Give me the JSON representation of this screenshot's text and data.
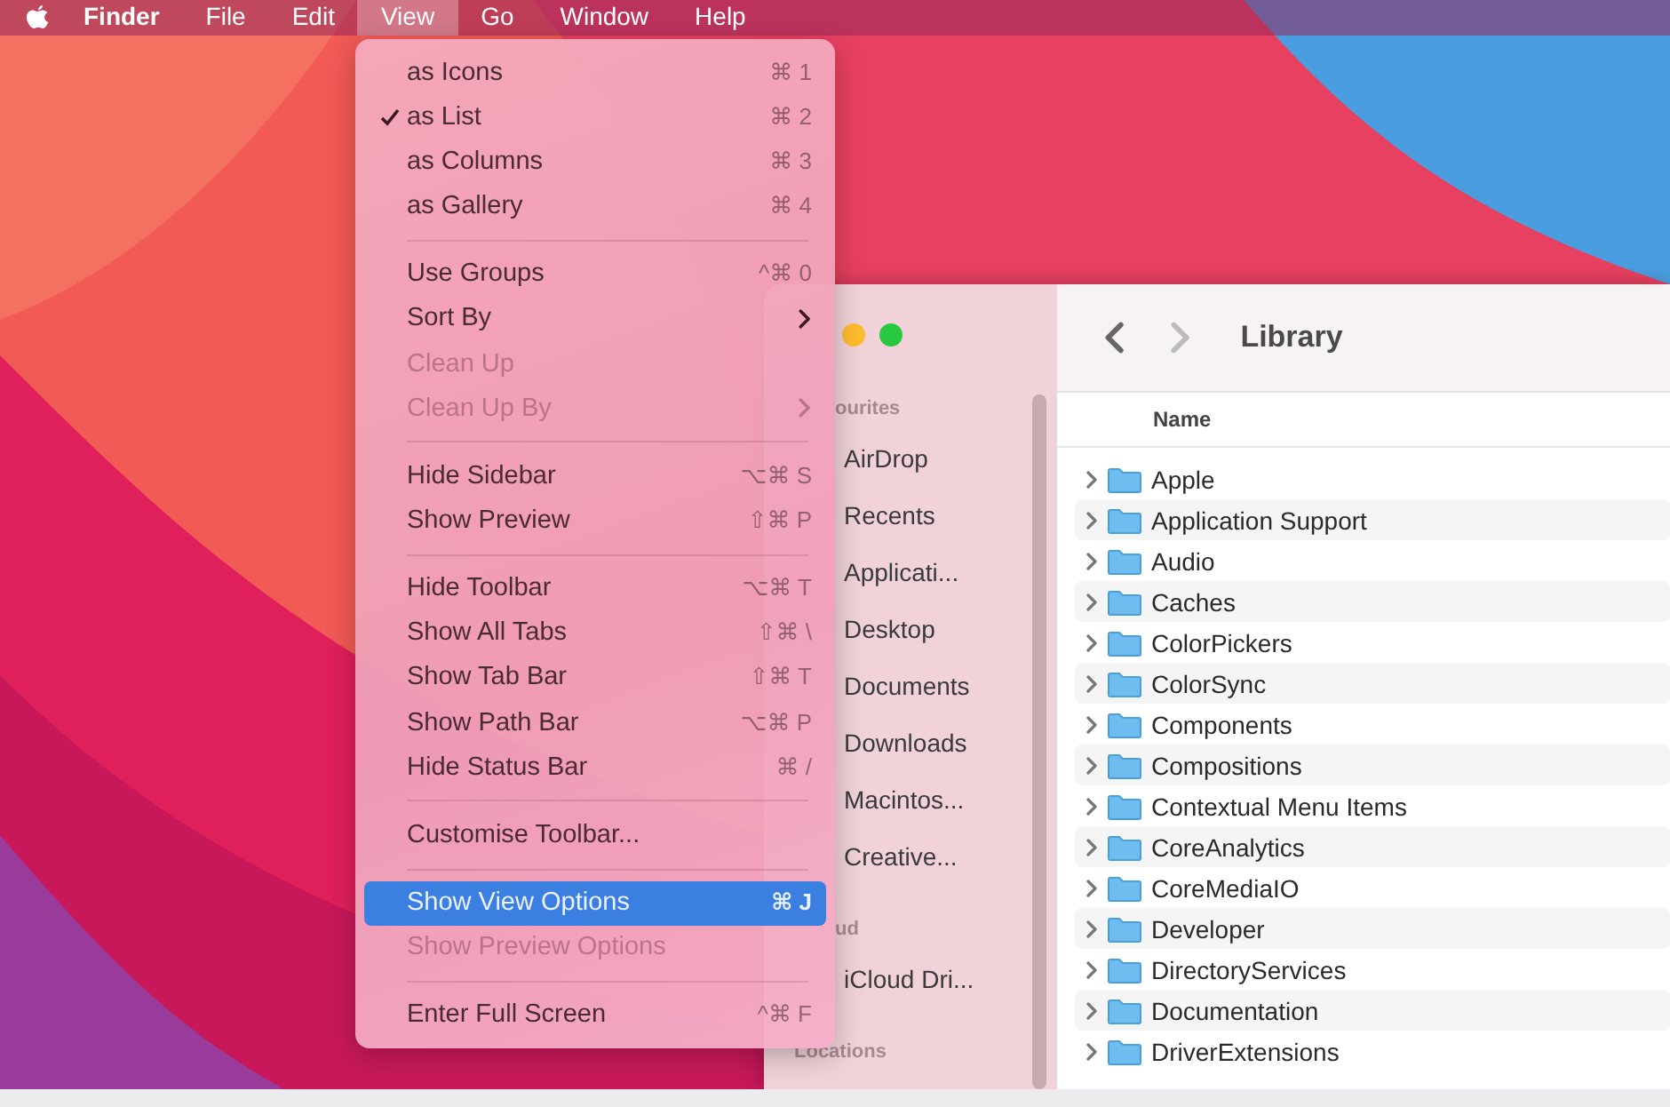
{
  "menubar": {
    "items": [
      {
        "label": "Finder",
        "kind": "app",
        "selected": false
      },
      {
        "label": "File",
        "kind": "menu",
        "selected": false
      },
      {
        "label": "Edit",
        "kind": "menu",
        "selected": false
      },
      {
        "label": "View",
        "kind": "menu",
        "selected": true
      },
      {
        "label": "Go",
        "kind": "menu",
        "selected": false
      },
      {
        "label": "Window",
        "kind": "menu",
        "selected": false
      },
      {
        "label": "Help",
        "kind": "menu",
        "selected": false
      }
    ]
  },
  "view_menu": {
    "items": [
      {
        "kind": "item",
        "label": "as Icons",
        "shortcut": "⌘ 1",
        "checked": false,
        "disabled": false,
        "selected": false,
        "submenu": false
      },
      {
        "kind": "item",
        "label": "as List",
        "shortcut": "⌘ 2",
        "checked": true,
        "disabled": false,
        "selected": false,
        "submenu": false
      },
      {
        "kind": "item",
        "label": "as Columns",
        "shortcut": "⌘ 3",
        "checked": false,
        "disabled": false,
        "selected": false,
        "submenu": false
      },
      {
        "kind": "item",
        "label": "as Gallery",
        "shortcut": "⌘ 4",
        "checked": false,
        "disabled": false,
        "selected": false,
        "submenu": false
      },
      {
        "kind": "separator"
      },
      {
        "kind": "item",
        "label": "Use Groups",
        "shortcut": "^⌘ 0",
        "checked": false,
        "disabled": false,
        "selected": false,
        "submenu": false
      },
      {
        "kind": "item",
        "label": "Sort By",
        "checked": false,
        "disabled": false,
        "selected": false,
        "submenu": true
      },
      {
        "kind": "item",
        "label": "Clean Up",
        "checked": false,
        "disabled": true,
        "selected": false,
        "submenu": false
      },
      {
        "kind": "item",
        "label": "Clean Up By",
        "checked": false,
        "disabled": true,
        "selected": false,
        "submenu": true
      },
      {
        "kind": "separator"
      },
      {
        "kind": "item",
        "label": "Hide Sidebar",
        "shortcut": "⌥⌘ S",
        "checked": false,
        "disabled": false,
        "selected": false,
        "submenu": false
      },
      {
        "kind": "item",
        "label": "Show Preview",
        "shortcut": "⇧⌘ P",
        "checked": false,
        "disabled": false,
        "selected": false,
        "submenu": false
      },
      {
        "kind": "separator"
      },
      {
        "kind": "item",
        "label": "Hide Toolbar",
        "shortcut": "⌥⌘ T",
        "checked": false,
        "disabled": false,
        "selected": false,
        "submenu": false
      },
      {
        "kind": "item",
        "label": "Show All Tabs",
        "shortcut": "⇧⌘ \\",
        "checked": false,
        "disabled": false,
        "selected": false,
        "submenu": false
      },
      {
        "kind": "item",
        "label": "Show Tab Bar",
        "shortcut": "⇧⌘ T",
        "checked": false,
        "disabled": false,
        "selected": false,
        "submenu": false
      },
      {
        "kind": "item",
        "label": "Show Path Bar",
        "shortcut": "⌥⌘ P",
        "checked": false,
        "disabled": false,
        "selected": false,
        "submenu": false
      },
      {
        "kind": "item",
        "label": "Hide Status Bar",
        "shortcut": "⌘ /",
        "checked": false,
        "disabled": false,
        "selected": false,
        "submenu": false
      },
      {
        "kind": "separator"
      },
      {
        "kind": "item",
        "label": "Customise Toolbar...",
        "checked": false,
        "disabled": false,
        "selected": false,
        "submenu": false
      },
      {
        "kind": "separator"
      },
      {
        "kind": "item",
        "label": "Show View Options",
        "shortcut": "⌘ J",
        "checked": false,
        "disabled": false,
        "selected": true,
        "submenu": false
      },
      {
        "kind": "item",
        "label": "Show Preview Options",
        "checked": false,
        "disabled": true,
        "selected": false,
        "submenu": false
      },
      {
        "kind": "separator"
      },
      {
        "kind": "item",
        "label": "Enter Full Screen",
        "shortcut": "^⌘ F",
        "checked": false,
        "disabled": false,
        "selected": false,
        "submenu": false
      }
    ]
  },
  "finder": {
    "title": "Library",
    "sidebar": {
      "sections": [
        {
          "heading": "ourites",
          "items": [
            "AirDrop",
            "Recents",
            "Applicati...",
            "Desktop",
            "Documents",
            "Downloads",
            "Macintos...",
            "Creative..."
          ]
        },
        {
          "heading": "ud",
          "items": [
            "iCloud Dri..."
          ]
        },
        {
          "heading": "Locations"
        }
      ]
    },
    "table": {
      "columns": [
        "Name"
      ],
      "rows": [
        "Apple",
        "Application Support",
        "Audio",
        "Caches",
        "ColorPickers",
        "ColorSync",
        "Components",
        "Compositions",
        "Contextual Menu Items",
        "CoreAnalytics",
        "CoreMediaIO",
        "Developer",
        "DirectoryServices",
        "Documentation",
        "DriverExtensions"
      ]
    }
  }
}
